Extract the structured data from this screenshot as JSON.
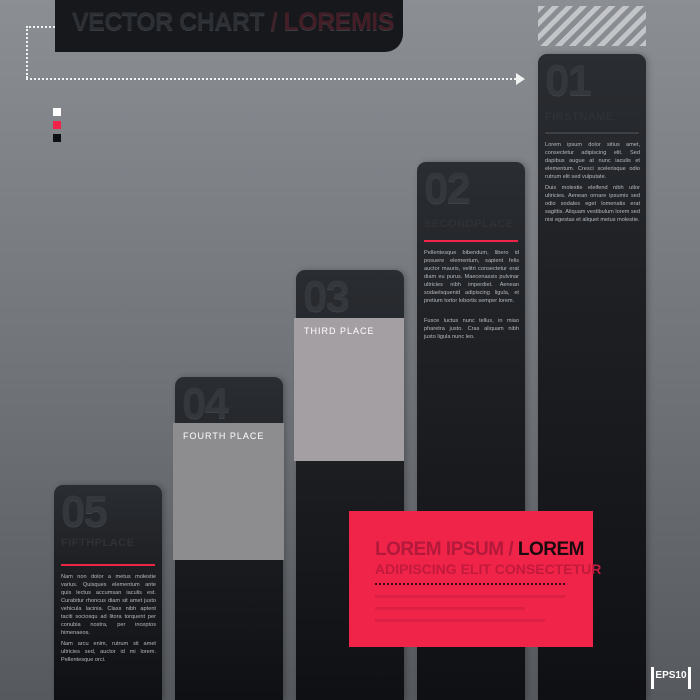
{
  "title": {
    "part1": "VECTOR CHART",
    "sep": "/",
    "part2": "LOREMIS"
  },
  "legend_colors": [
    "#ffffff",
    "#f02349",
    "#0f1013"
  ],
  "accent": "#f02349",
  "columns": [
    {
      "number": "01",
      "heading": "FIRSTNAME",
      "rule_color": "#3d4045",
      "paragraphs": [
        "Lorem ipsum dolor sitius amet, consectetur adipiscing elit. Sed dapibus augue at nunc iaculis et elementum. Cresci scelerisque odio rutrum elit sed vulputate.",
        "Duis molestie eleifend nibh utlor ultricies. Aenean ornare ipsumis sed odio sodales eget lomenatis erat sagittis. Aliquam vestibulum lorem sed nisi egestas et aliquet metus molestie."
      ]
    },
    {
      "number": "02",
      "heading": "SECONDPLACE",
      "rule_color": "#f02349",
      "paragraphs": [
        "Pellentesque bibendum, libero id posuere elementum, sapient felis auctor mauris, velitri consectetur erat diam eu purus. Maecenassis pulvinar ultricies nibh imperdiet. Aenean sodaelsquenid adipiscing ligula, et pretium tortor lobortis semper lorem.",
        "Fusce luctus nunc tellus, in miao pharetra justo. Cras aliquam nibh justo ligula nunc leo."
      ]
    },
    {
      "number": "03",
      "heading": "THIRD PLACE",
      "rule_color": "#3d4045",
      "paragraphs": []
    },
    {
      "number": "04",
      "heading": "FOURTH PLACE",
      "rule_color": "#3d4045",
      "paragraphs": []
    },
    {
      "number": "05",
      "heading": "FIFTHPLACE",
      "rule_color": "#f02349",
      "paragraphs": [
        "Nam non dolor a metus molestie varius. Quisques elementum ante quis lectus accumsan iaculis est. Curabitur rhoncus diam sit amet justo vehicula lacinia. Class nibh aptent taciti sociosqu ad litora torquent per conubia nostra, per inceptos himenaeos.",
        "Nam arcu enim, rutrum sit amet ultricies sed, auctor id mi lorem. Pellentesque orci."
      ]
    }
  ],
  "overlays": {
    "third": "THIRD PLACE",
    "fourth": "FOURTH PLACE"
  },
  "red_box": {
    "line1_dim": "LOREM IPSUM",
    "sep": "/",
    "line1_bright": "LOREM",
    "line2": "ADIPISCING ELIT CONSECTETUR"
  },
  "badge": "EPS10"
}
